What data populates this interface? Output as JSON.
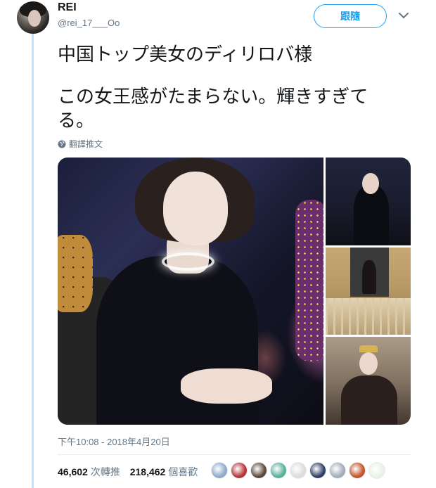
{
  "user": {
    "display_name": "REI",
    "handle": "@rei_17___Oo"
  },
  "header": {
    "follow_label": "跟隨"
  },
  "tweet": {
    "line1": "中国トップ美女のディリロバ様",
    "line2": "この女王感がたまらない。輝きすぎて",
    "line3": "る。",
    "translate_label": "翻譯推文",
    "timestamp": "下午10:08 - 2018年4月20日"
  },
  "stats": {
    "retweets_count": "46,602",
    "retweets_label": "次轉推",
    "likes_count": "218,462",
    "likes_label": "個喜歡"
  },
  "likers": [
    {
      "name": "liker-avatar-1",
      "color": "#8fa9c7"
    },
    {
      "name": "liker-avatar-2",
      "color": "#b5343a"
    },
    {
      "name": "liker-avatar-3",
      "color": "#5a4a3c"
    },
    {
      "name": "liker-avatar-4",
      "color": "#58b09a"
    },
    {
      "name": "liker-avatar-5",
      "color": "#dcdcdc"
    },
    {
      "name": "liker-avatar-6",
      "color": "#2f3f63"
    },
    {
      "name": "liker-avatar-7",
      "color": "#a3adb8"
    },
    {
      "name": "liker-avatar-8",
      "color": "#c2552b"
    },
    {
      "name": "liker-avatar-9",
      "color": "#e9f2e4"
    }
  ],
  "colors": {
    "accent": "#1da1f2",
    "thread_line": "#bfe3f9",
    "secondary_text": "#657786"
  }
}
